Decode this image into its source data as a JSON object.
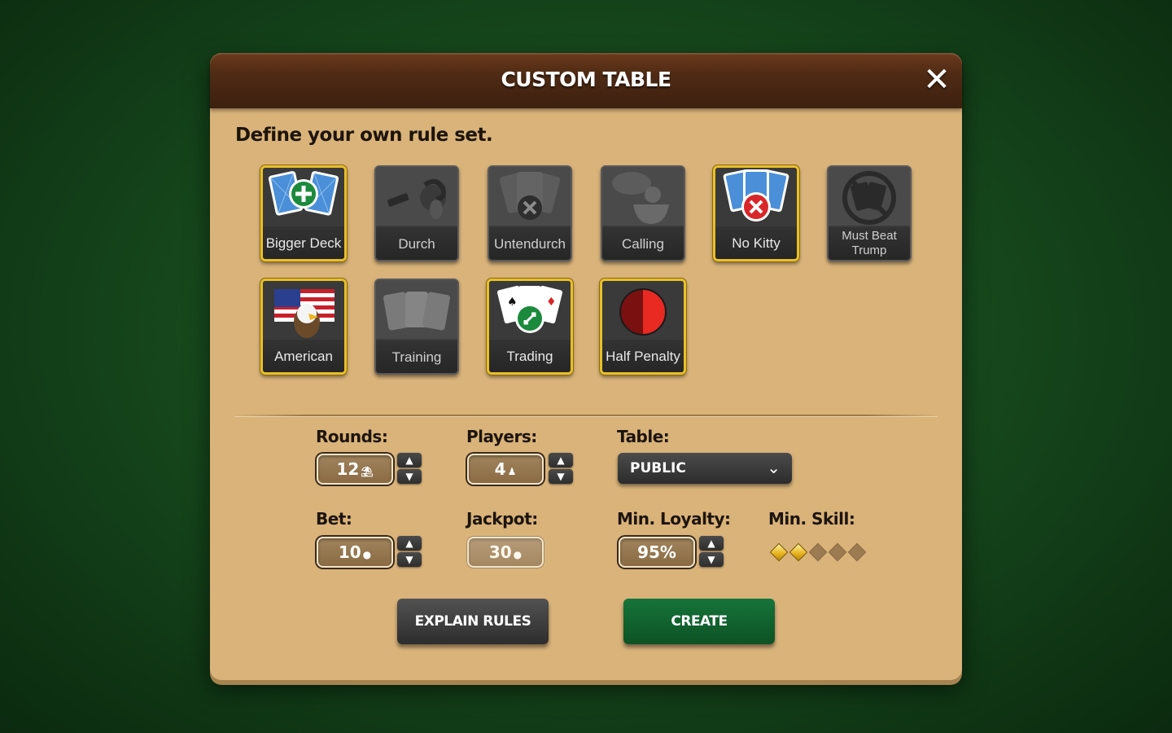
{
  "dialog": {
    "title": "CUSTOM TABLE",
    "close_label": "✕",
    "subtitle": "Define your own rule set."
  },
  "rules": [
    {
      "label": "Bigger Deck",
      "enabled": true,
      "icon": "cards-plus-icon"
    },
    {
      "label": "Durch",
      "enabled": false,
      "icon": "ram-icon"
    },
    {
      "label": "Untendurch",
      "enabled": false,
      "icon": "cards-x-icon"
    },
    {
      "label": "Calling",
      "enabled": false,
      "icon": "speech-bubble-icon"
    },
    {
      "label": "No Kitty",
      "enabled": true,
      "icon": "cards-x-icon"
    },
    {
      "label": "Must Beat Trump",
      "enabled": false,
      "icon": "no-card-icon"
    },
    {
      "label": "American",
      "enabled": true,
      "icon": "eagle-flag-icon"
    },
    {
      "label": "Training",
      "enabled": false,
      "icon": "cards-fan-icon"
    },
    {
      "label": "Trading",
      "enabled": true,
      "icon": "cards-swap-icon"
    },
    {
      "label": "Half Penalty",
      "enabled": true,
      "icon": "half-circle-icon"
    }
  ],
  "settings": {
    "rounds": {
      "label": "Rounds:",
      "value": "12"
    },
    "players": {
      "label": "Players:",
      "value": "4"
    },
    "table": {
      "label": "Table:",
      "value": "PUBLIC"
    },
    "bet": {
      "label": "Bet:",
      "value": "10"
    },
    "jackpot": {
      "label": "Jackpot:",
      "value": "30"
    },
    "loyalty": {
      "label": "Min. Loyalty:",
      "value": "95%"
    },
    "skill": {
      "label": "Min. Skill:",
      "level": 2,
      "max": 5
    }
  },
  "buttons": {
    "explain": "EXPLAIN RULES",
    "create": "CREATE"
  },
  "colors": {
    "panel": "#d9b37a",
    "header": "#4e2a14",
    "active_border": "#e8bf2a",
    "create": "#16743a"
  }
}
